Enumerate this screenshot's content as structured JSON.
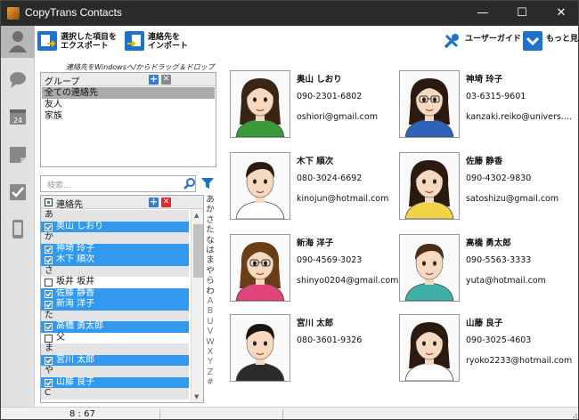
{
  "window": {
    "title": "CopyTrans Contacts"
  },
  "toolbar": {
    "export_label": "選択した項目を\nエクスポート",
    "import_label": "連絡先を\nインポート",
    "guide_label": "ユーザーガイド",
    "more_label": "もっと見る"
  },
  "hint": "連絡先をWindowsへ/からドラッグ＆ドロップ",
  "groups": {
    "header": "グループ",
    "items": [
      "全ての連絡先",
      "友人",
      "家族"
    ]
  },
  "search": {
    "placeholder": "検索..."
  },
  "contacts_list": {
    "header": "連絡先",
    "rows": [
      {
        "type": "section",
        "label": "あ"
      },
      {
        "type": "item",
        "label": "奥山 しおり",
        "checked": true
      },
      {
        "type": "section",
        "label": "か"
      },
      {
        "type": "item",
        "label": "神埼 玲子",
        "checked": true
      },
      {
        "type": "item",
        "label": "木下 順次",
        "checked": true
      },
      {
        "type": "section",
        "label": "さ"
      },
      {
        "type": "item",
        "label": "坂井 坂井",
        "checked": false
      },
      {
        "type": "item",
        "label": "佐藤 静香",
        "checked": true
      },
      {
        "type": "item",
        "label": "新海 洋子",
        "checked": true
      },
      {
        "type": "section",
        "label": "た"
      },
      {
        "type": "item",
        "label": "高橋 勇太郎",
        "checked": true
      },
      {
        "type": "item",
        "label": "父",
        "checked": false
      },
      {
        "type": "section",
        "label": "ま"
      },
      {
        "type": "item",
        "label": "宮川 太郎",
        "checked": true
      },
      {
        "type": "section",
        "label": "や"
      },
      {
        "type": "item",
        "label": "山藤 良子",
        "checked": true
      },
      {
        "type": "section",
        "label": "C"
      }
    ]
  },
  "alphabet": [
    "あ",
    "か",
    "さ",
    "た",
    "な",
    "は",
    "ま",
    "や",
    "ら",
    "わ",
    "A",
    "B",
    "U",
    "V",
    "W",
    "X",
    "Y",
    "Z",
    "#"
  ],
  "cards": [
    {
      "name": "奥山 しおり",
      "phone": "090-2301-6802",
      "email": "oshiori@gmail.com"
    },
    {
      "name": "神埼 玲子",
      "phone": "03-6315-9601",
      "email": "kanzaki.reiko@univers...."
    },
    {
      "name": "木下 順次",
      "phone": "080-3024-6692",
      "email": "kinojun@hotmail.com"
    },
    {
      "name": "佐藤 静香",
      "phone": "090-4302-9830",
      "email": "satoshizu@gmail.com"
    },
    {
      "name": "新海 洋子",
      "phone": "090-4569-3023",
      "email": "shinyo0204@gmail.com"
    },
    {
      "name": "高橋 勇太郎",
      "phone": "090-5563-3333",
      "email": "yuta@hotmail.com"
    },
    {
      "name": "宮川 太郎",
      "phone": "080-3601-9326",
      "email": ""
    },
    {
      "name": "山藤 良子",
      "phone": "090-3025-4603",
      "email": "ryoko2233@hotmail.com"
    }
  ],
  "status": {
    "count": "8 : 67"
  },
  "colors": {
    "accent": "#3399ee",
    "titlebar": "#2b2b2b",
    "selected_group": "#aaaaaa"
  }
}
